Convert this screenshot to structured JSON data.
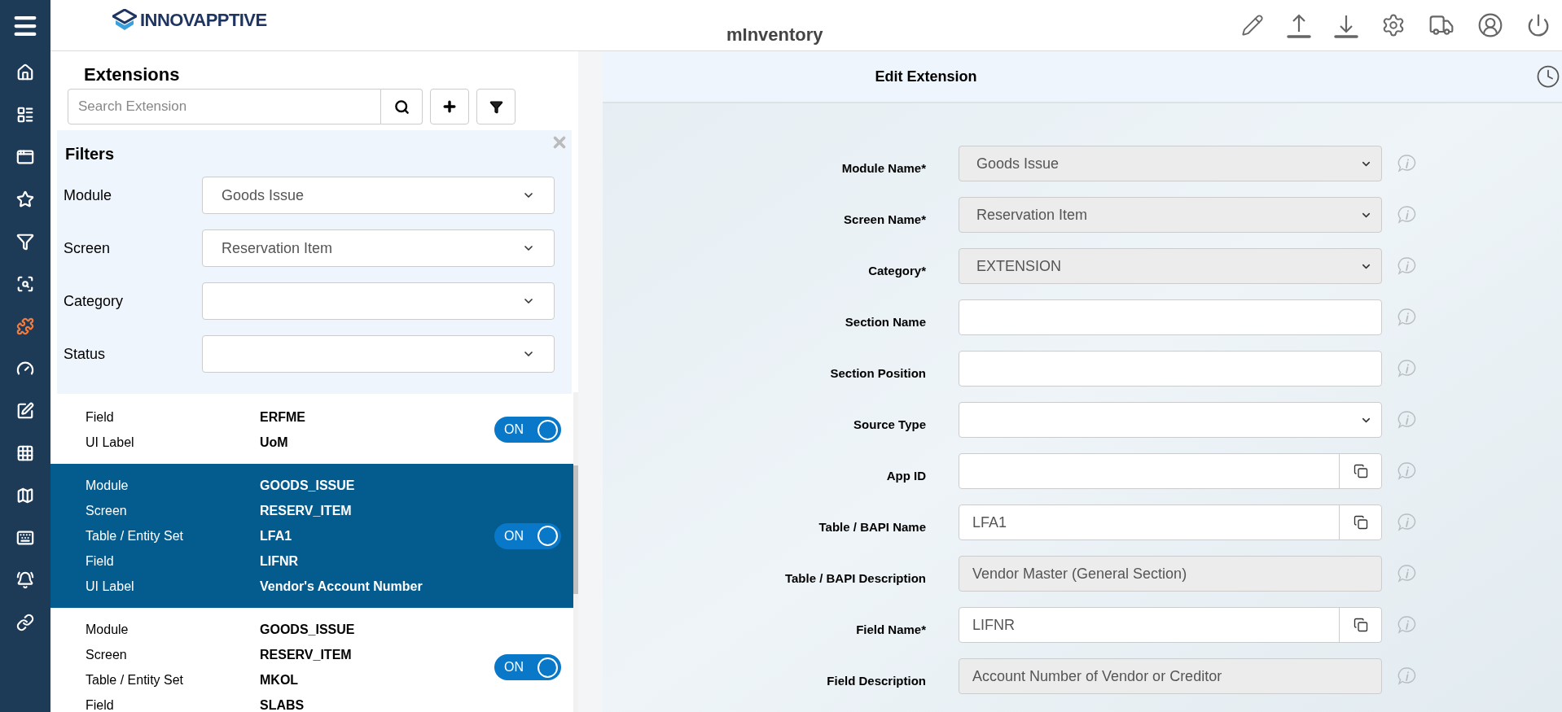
{
  "header": {
    "logo_text": "INNOVAPPTIVE",
    "app_title": "mInventory"
  },
  "sidebar": {
    "items": [
      {
        "selected": false
      },
      {
        "selected": false
      },
      {
        "selected": false
      },
      {
        "selected": false
      },
      {
        "selected": false
      },
      {
        "selected": false
      },
      {
        "selected": true
      },
      {
        "selected": false
      },
      {
        "selected": false
      },
      {
        "selected": false
      },
      {
        "selected": false
      },
      {
        "selected": false
      },
      {
        "selected": false
      },
      {
        "selected": false
      }
    ]
  },
  "extensions_panel": {
    "title": "Extensions",
    "search": {
      "placeholder": "Search Extension"
    },
    "filters": {
      "title": "Filters",
      "fields": [
        {
          "label": "Module",
          "value": "Goods Issue"
        },
        {
          "label": "Screen",
          "value": "Reservation Item"
        },
        {
          "label": "Category"
        },
        {
          "label": "Status"
        }
      ]
    },
    "list": [
      {
        "selected": false,
        "on": true,
        "toggle_label": "ON",
        "rows": [
          {
            "label": "Field",
            "value": "ERFME"
          },
          {
            "label": "UI Label",
            "value": "UoM"
          }
        ]
      },
      {
        "selected": true,
        "on": true,
        "toggle_label": "ON",
        "rows": [
          {
            "label": "Module",
            "value": "GOODS_ISSUE"
          },
          {
            "label": "Screen",
            "value": "RESERV_ITEM"
          },
          {
            "label": "Table / Entity Set",
            "value": "LFA1"
          },
          {
            "label": "Field",
            "value": "LIFNR"
          },
          {
            "label": "UI Label",
            "value": "Vendor's Account Number"
          }
        ]
      },
      {
        "selected": false,
        "on": true,
        "toggle_label": "ON",
        "rows": [
          {
            "label": "Module",
            "value": "GOODS_ISSUE"
          },
          {
            "label": "Screen",
            "value": "RESERV_ITEM"
          },
          {
            "label": "Table / Entity Set",
            "value": "MKOL"
          },
          {
            "label": "Field",
            "value": "SLABS"
          }
        ]
      }
    ]
  },
  "edit_panel": {
    "title": "Edit Extension",
    "fields": [
      {
        "label": "Module Name*",
        "kind": "select",
        "disabled": true,
        "value": "Goods Issue"
      },
      {
        "label": "Screen Name*",
        "kind": "select",
        "disabled": true,
        "value": "Reservation Item"
      },
      {
        "label": "Category*",
        "kind": "select",
        "disabled": true,
        "value": "EXTENSION"
      },
      {
        "label": "Section Name",
        "kind": "text",
        "disabled": false
      },
      {
        "label": "Section Position",
        "kind": "text",
        "disabled": false
      },
      {
        "label": "Source Type",
        "kind": "select",
        "disabled": false
      },
      {
        "label": "App ID",
        "kind": "lookup",
        "disabled": false
      },
      {
        "label": "Table / BAPI Name",
        "kind": "lookup",
        "disabled": false,
        "value": "LFA1"
      },
      {
        "label": "Table / BAPI Description",
        "kind": "text",
        "disabled": true,
        "value": "Vendor Master (General Section)"
      },
      {
        "label": "Field Name*",
        "kind": "lookup",
        "disabled": false,
        "value": "LIFNR"
      },
      {
        "label": "Field Description",
        "kind": "text",
        "disabled": true,
        "value": "Account Number of Vendor or Creditor"
      }
    ]
  }
}
